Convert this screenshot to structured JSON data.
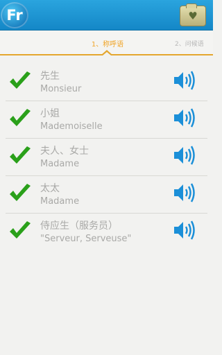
{
  "header": {
    "logo_text": "Fr",
    "favorites_icon": "heart-folder-icon",
    "favorites_glyph": "♥"
  },
  "tabs": {
    "active_label": "1、称呼语",
    "next_label": "2、问候语"
  },
  "colors": {
    "header_blue": "#1b93d2",
    "tab_accent": "#f0a52a",
    "check_green": "#2aa01a",
    "speaker_blue": "#1b8fd8",
    "text_gray": "#a9a9a7"
  },
  "phrases": [
    {
      "zh": "先生",
      "fr": "Monsieur",
      "learned": true
    },
    {
      "zh": "小姐",
      "fr": "Mademoiselle",
      "learned": true
    },
    {
      "zh": "夫人、女士",
      "fr": "Madame",
      "learned": true
    },
    {
      "zh": "太太",
      "fr": "Madame",
      "learned": true
    },
    {
      "zh": "侍应生（服务员）",
      "fr": "\"Serveur, Serveuse\"",
      "learned": true
    }
  ],
  "icons": {
    "check": "checkmark-icon",
    "speaker": "speaker-icon"
  }
}
